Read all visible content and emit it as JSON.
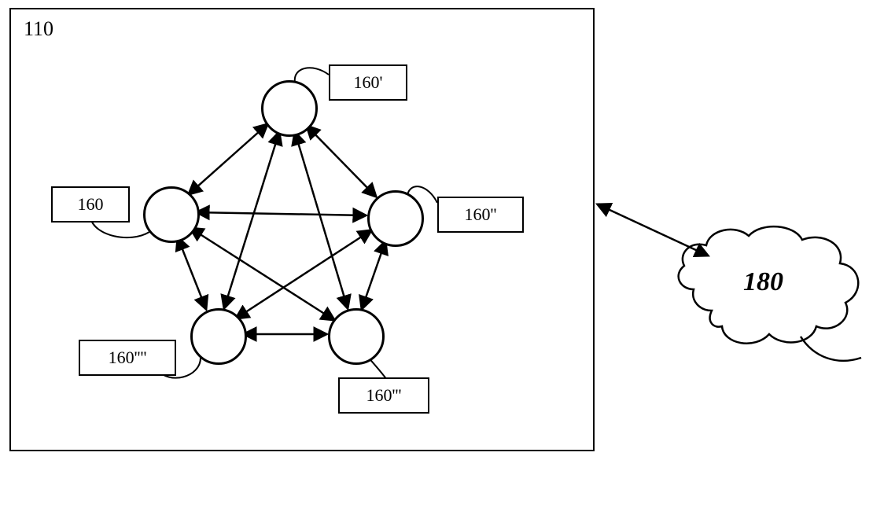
{
  "diagram": {
    "container_ref": "110",
    "nodes": {
      "top": {
        "label": "160'"
      },
      "left": {
        "label": "160"
      },
      "right": {
        "label": "160''"
      },
      "bl": {
        "label": "160''''"
      },
      "br": {
        "label": "160'''"
      }
    },
    "cloud": {
      "label": "180"
    }
  }
}
